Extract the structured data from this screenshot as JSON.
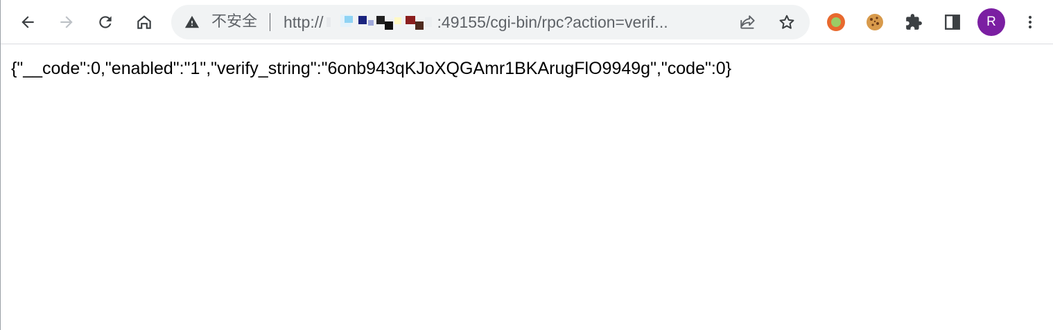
{
  "browser": {
    "omnibox": {
      "security_label": "不安全",
      "url_prefix": "http://",
      "url_rest": ":49155/cgi-bin/rpc?action=verif..."
    },
    "profile": {
      "initial": "R",
      "color": "#7b1fa2"
    },
    "icons": {
      "back": "arrow-left-icon",
      "forward": "arrow-right-icon",
      "reload": "reload-icon",
      "home": "home-icon",
      "warning": "warning-triangle-icon",
      "share": "share-icon",
      "bookmark": "star-icon",
      "extension_circle": "circle-extension-icon",
      "extension_cookie": "cookie-icon",
      "extensions": "puzzle-icon",
      "side_panel": "side-panel-icon",
      "menu": "kebab-menu-icon"
    }
  },
  "page": {
    "body_text": "{\"__code\":0,\"enabled\":\"1\",\"verify_string\":\"6onb943qKJoXQGAmr1BKArugFlO9949g\",\"code\":0}"
  }
}
